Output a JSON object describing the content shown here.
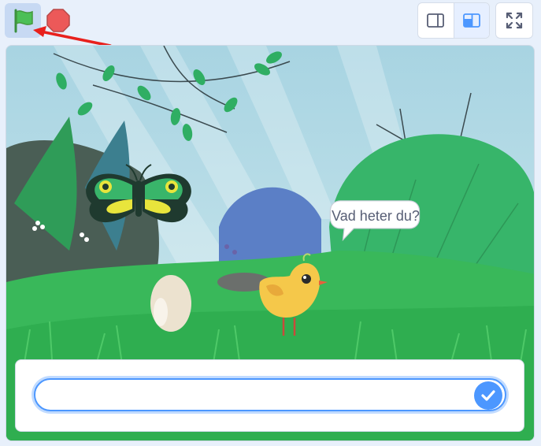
{
  "toolbar": {
    "green_flag_icon": "green-flag-icon",
    "stop_icon": "stop-icon",
    "view_modes": [
      "small-stage-icon",
      "normal-stage-icon"
    ],
    "active_view_mode": "normal-stage-icon",
    "fullscreen_icon": "fullscreen-icon"
  },
  "stage": {
    "speech_bubble": {
      "text": "Vad heter du?"
    },
    "ask_prompt": {
      "input_value": ""
    }
  },
  "colors": {
    "accent": "#4c97ff",
    "flag_green": "#4cbf56",
    "stop_red": "#ec5959",
    "annotation_arrow": "#e8201c"
  }
}
